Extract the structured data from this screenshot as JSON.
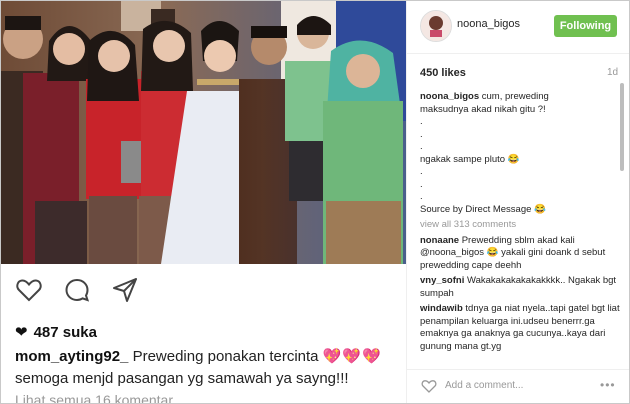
{
  "left": {
    "likes_text": "487 suka",
    "caption_user": "mom_ayting92_",
    "caption_line1": "Preweding ponakan tercinta",
    "caption_line2": "semoga menjd pasangan yg samawah ya sayng!!!",
    "hearts": "💖💖💖",
    "view_all": "Lihat semua 16 komentar"
  },
  "right": {
    "username": "noona_bigos",
    "follow_label": "Following",
    "likes": "450 likes",
    "age": "1d",
    "caption_user": "noona_bigos",
    "caption_line1": "cum, preweding",
    "caption_line2": "maksudnya akad nikah gitu ?!",
    "caption_dot1": ".",
    "caption_dot2": ".",
    "caption_dot3": ".",
    "caption_line3": "ngakak sampe pluto 😂",
    "caption_dot4": ".",
    "caption_dot5": ".",
    "caption_dot6": ".",
    "caption_source": "Source by Direct Message 😂",
    "view_all": "view all 313 comments",
    "comments": [
      {
        "user": "nonaane",
        "text": "Prewedding sblm akad kali @noona_bigos 😂 yakali gini doank d sebut prewedding cape deehh"
      },
      {
        "user": "vny_sofni",
        "text": "Wakakakakakakakkkk.. Ngakak bgt sumpah"
      },
      {
        "user": "windawib",
        "text": "tdnya ga niat nyela..tapi gatel bgt liat penampilan keluarga ini.udseu benerrr.ga emaknya ga anaknya ga cucunya..kaya dari gunung mana gt.yg"
      }
    ],
    "add_comment": "Add a comment...",
    "more": "•••"
  },
  "colors": {
    "follow_green": "#70c050",
    "text": "#262626",
    "muted": "#999999",
    "heart_pink": "#e05a9a"
  },
  "icons": [
    "heart-icon",
    "comment-icon",
    "share-icon",
    "more-icon"
  ]
}
